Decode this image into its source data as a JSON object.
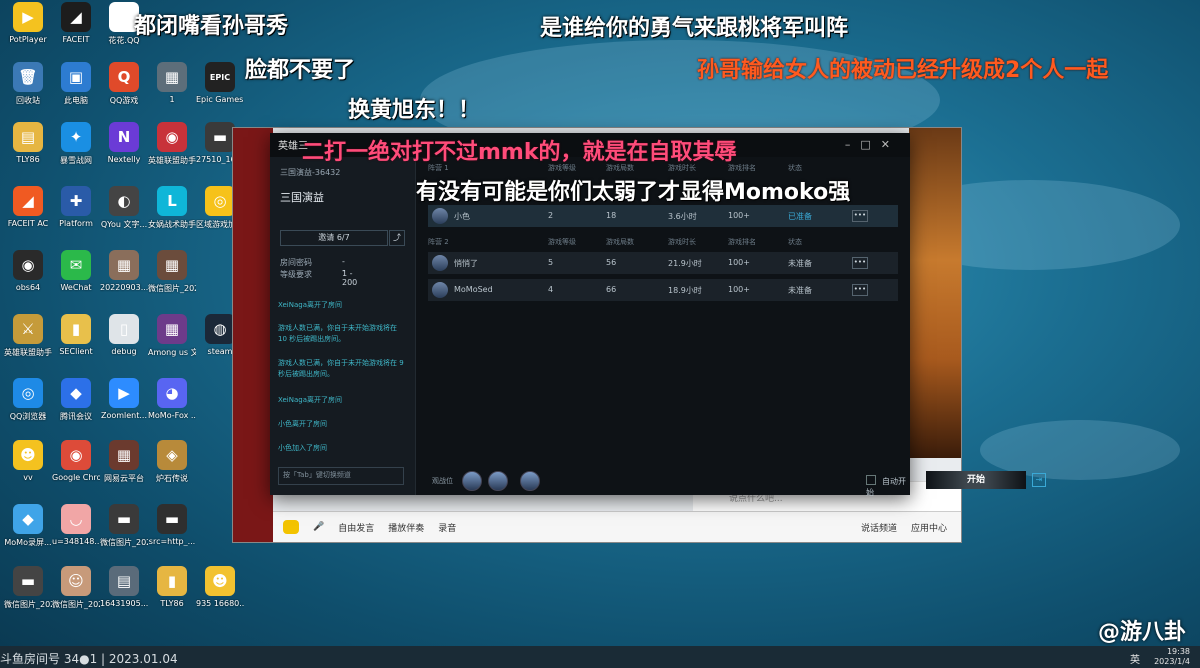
{
  "desktop_icons": [
    {
      "label": "PotPlayer",
      "glyph": "▶",
      "color": "#f4c21f"
    },
    {
      "label": "FACEIT",
      "glyph": "◢",
      "color": "#1d1d1d"
    },
    {
      "label": "花花.QQ",
      "glyph": "Q",
      "color": "#ffffff"
    },
    {
      "label": "回收站",
      "glyph": "🗑",
      "color": "#3b79b5"
    },
    {
      "label": "此电脑",
      "glyph": "▣",
      "color": "#2d7cd1"
    },
    {
      "label": "QQ游戏",
      "glyph": "Q",
      "color": "#e04a2a"
    },
    {
      "label": "1",
      "glyph": "▦",
      "color": "#5d6e7a"
    },
    {
      "label": "Epic Games Launcher",
      "glyph": "EPIC",
      "color": "#222222"
    },
    {
      "label": "TLY86",
      "glyph": "▤",
      "color": "#e6b642"
    },
    {
      "label": "暴雪战网",
      "glyph": "✦",
      "color": "#1a8fe3"
    },
    {
      "label": "Nextelly",
      "glyph": "N",
      "color": "#6b3bd6"
    },
    {
      "label": "英雄联盟助手",
      "glyph": "◉",
      "color": "#c8323a"
    },
    {
      "label": "27510_165...",
      "glyph": "▬",
      "color": "#3a3a3a"
    },
    {
      "label": "FACEIT AC",
      "glyph": "◢",
      "color": "#f05a22"
    },
    {
      "label": "Platform",
      "glyph": "✚",
      "color": "#2a5ba8"
    },
    {
      "label": "QYou 文字...",
      "glyph": "◐",
      "color": "#444444"
    },
    {
      "label": "女娲战术助手",
      "glyph": "L",
      "color": "#0fb6d8"
    },
    {
      "label": "区域游戏加速器",
      "glyph": "◎",
      "color": "#f6c21a"
    },
    {
      "label": "obs64",
      "glyph": "◉",
      "color": "#2a2a2a"
    },
    {
      "label": "WeChat",
      "glyph": "✉",
      "color": "#2bb94a"
    },
    {
      "label": "20220903...",
      "glyph": "▦",
      "color": "#8a6e5b"
    },
    {
      "label": "微信图片_20221116...",
      "glyph": "▦",
      "color": "#6b4c3c"
    },
    {
      "label": "英雄联盟助手中国",
      "glyph": "⚔",
      "color": "#c59b3a"
    },
    {
      "label": "SEClient",
      "glyph": "▮",
      "color": "#e8c04b"
    },
    {
      "label": "debug",
      "glyph": "▯",
      "color": "#dfe4e8"
    },
    {
      "label": "Among us 文件Mod...",
      "glyph": "▦",
      "color": "#6d3b8a"
    },
    {
      "label": "steam",
      "glyph": "◍",
      "color": "#1b2838"
    },
    {
      "label": "QQ浏览器",
      "glyph": "◎",
      "color": "#1e8ae6"
    },
    {
      "label": "腾讯会议",
      "glyph": "◆",
      "color": "#2c70e8"
    },
    {
      "label": "Zoomlent...",
      "glyph": "▶",
      "color": "#2d8cff"
    },
    {
      "label": "MoMo-Fox ...",
      "glyph": "◕",
      "color": "#5865f2"
    },
    {
      "label": "vv",
      "glyph": "☻",
      "color": "#f4c21f"
    },
    {
      "label": "Google Chrome",
      "glyph": "◉",
      "color": "#dd4b39"
    },
    {
      "label": "网易云平台",
      "glyph": "▦",
      "color": "#6b3a2e"
    },
    {
      "label": "炉石传说",
      "glyph": "◈",
      "color": "#b88a3a"
    },
    {
      "label": "MoMo录屏...",
      "glyph": "◆",
      "color": "#3fa4e8"
    },
    {
      "label": "u=348148...",
      "glyph": "◡",
      "color": "#f1a6a6"
    },
    {
      "label": "微信图片_20210...",
      "glyph": "▬",
      "color": "#3a3a3a"
    },
    {
      "label": "src=http_...",
      "glyph": "▬",
      "color": "#2f2f2f"
    },
    {
      "label": "微信图片_2022081...",
      "glyph": "▬",
      "color": "#444444"
    },
    {
      "label": "微信图片_2022081...",
      "glyph": "☺",
      "color": "#c79a7a"
    },
    {
      "label": "16431905...",
      "glyph": "▤",
      "color": "#5a6b7a"
    },
    {
      "label": "TLY86",
      "glyph": "▮",
      "color": "#e6b642"
    },
    {
      "label": "935 16680...",
      "glyph": "☻",
      "color": "#f2c230"
    }
  ],
  "danmaku": [
    {
      "text": "都闭嘴看孙哥秀",
      "style": "dm-white"
    },
    {
      "text": "是谁给你的勇气来跟桃将军叫阵",
      "style": "dm-white"
    },
    {
      "text": "脸都不要了",
      "style": "dm-white"
    },
    {
      "text": "孙哥输给女人的被动已经升级成2个人一起",
      "style": "dm-orange"
    },
    {
      "text": "换黄旭东！！",
      "style": "dm-white"
    },
    {
      "text": "二打一绝对打不过mmk的，就是在自取其辱",
      "style": "dm-pink"
    },
    {
      "text": "有没有可能是你们太弱了才显得Momoko强",
      "style": "dm-white"
    }
  ],
  "client": {
    "room_id": "三国演益-36432",
    "room_name": "三国演益",
    "invite_label": "邀请 6/7",
    "info": [
      {
        "k": "房间密码",
        "v": "--"
      },
      {
        "k": "等级要求",
        "v": "1 - 200"
      }
    ],
    "log": [
      "XeiNaga离开了房间",
      "游戏人数已满，你自于未开始游戏将在 10 秒后被踢出房间。",
      "游戏人数已满，你自于未开始游戏将在 9 秒后被踢出房间。",
      "XeiNaga离开了房间",
      "小色离开了房间",
      "小色加入了房间"
    ],
    "chat_placeholder": "按「Tab」键切换频道",
    "chat_channel": "全部",
    "team1_label": "阵营 1",
    "team2_label": "阵营 2",
    "headers": [
      "游戏等级",
      "游戏局数",
      "游戏时长",
      "游戏排名",
      "状态"
    ],
    "team1": [
      {
        "name": "小色",
        "level": "2",
        "games": "18",
        "time": "3.6小时",
        "rank": "100+",
        "status": "已准备"
      }
    ],
    "team2": [
      {
        "name": "悄悄了",
        "level": "5",
        "games": "56",
        "time": "21.9小时",
        "rank": "100+",
        "status": "未准备"
      },
      {
        "name": "MoMoSed",
        "level": "4",
        "games": "66",
        "time": "18.9小时",
        "rank": "100+",
        "status": "未准备"
      }
    ],
    "spectate_label": "观战位",
    "auto_start": "自动开始",
    "start": "开始"
  },
  "browser": {
    "input_placeholder": "说点什么吧...",
    "bottom_items": [
      "自由发言",
      "播放伴奏",
      "录音"
    ],
    "right_items": [
      "说话频道",
      "应用中心"
    ]
  },
  "taskbar": {
    "live_text": "斗鱼房间号",
    "date_text": "| 2023.01.04",
    "lang": "英",
    "time": "19:38",
    "date": "2023/1/4"
  },
  "watermark": "@游八卦"
}
